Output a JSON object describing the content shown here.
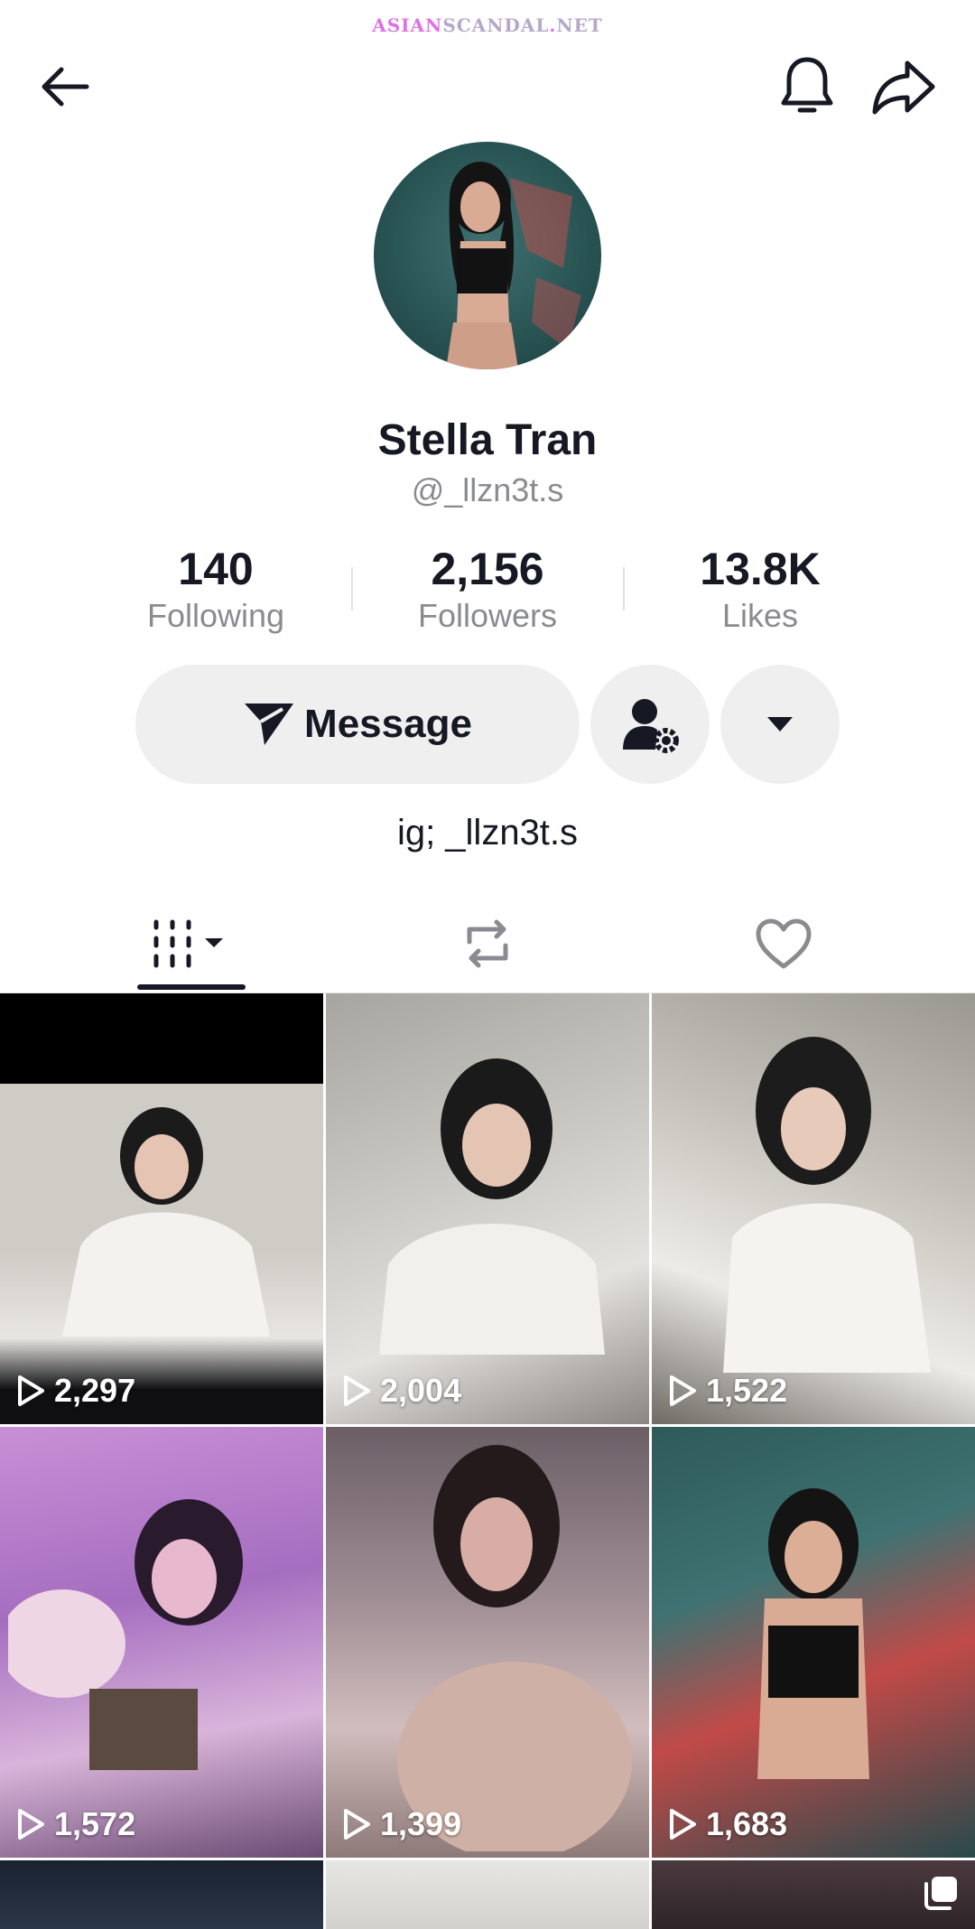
{
  "watermark": {
    "part1": "ASIAN",
    "part2": "SCANDAL",
    "dot": ".",
    "part3": "NET"
  },
  "header": {
    "back_icon": "arrow-left-icon",
    "bell_icon": "bell-icon",
    "share_icon": "share-icon"
  },
  "profile": {
    "display_name": "Stella Tran",
    "username": "@_llzn3t.s",
    "bio": "ig; _llzn3t.s"
  },
  "stats": [
    {
      "value": "140",
      "label": "Following"
    },
    {
      "value": "2,156",
      "label": "Followers"
    },
    {
      "value": "13.8K",
      "label": "Likes"
    }
  ],
  "actions": {
    "message_label": "Message",
    "message_icon": "send-icon",
    "follow_settings_icon": "user-gear-icon",
    "more_icon": "caret-down-icon"
  },
  "tabs": [
    {
      "name": "videos",
      "icon": "grid-columns-icon"
    },
    {
      "name": "reposts",
      "icon": "repost-icon"
    },
    {
      "name": "liked",
      "icon": "heart-icon"
    }
  ],
  "videos": [
    {
      "views": "2,297"
    },
    {
      "views": "2,004"
    },
    {
      "views": "1,522"
    },
    {
      "views": "1,572"
    },
    {
      "views": "1,399"
    },
    {
      "views": "1,683"
    }
  ],
  "colors": {
    "text_primary": "#161823",
    "text_secondary": "#8a8b91",
    "button_bg": "#efefef"
  }
}
